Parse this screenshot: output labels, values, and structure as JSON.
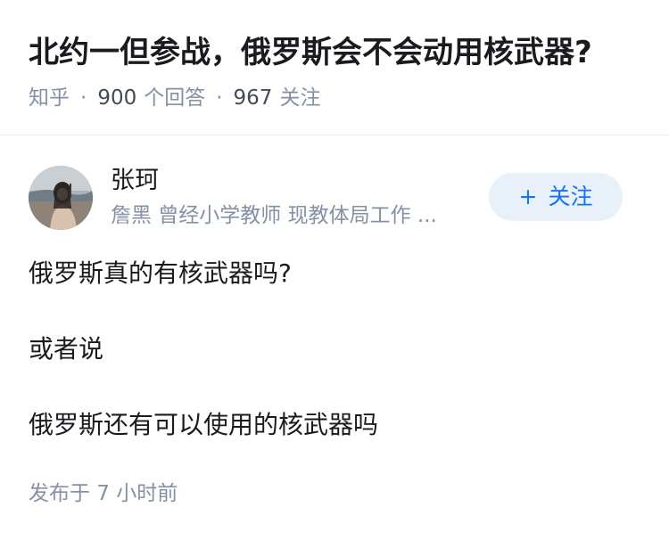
{
  "question": {
    "title": "北约一但参战，俄罗斯会不会动用核武器?",
    "source": "知乎",
    "answer_count": "900",
    "answer_label": "个回答",
    "follow_count": "967",
    "follow_label": "关注"
  },
  "author": {
    "name": "张珂",
    "bio": "詹黑 曾经小学教师 现教体局工作 ..."
  },
  "follow_button": {
    "plus": "+",
    "label": "关注"
  },
  "answer": {
    "paragraphs": [
      "俄罗斯真的有核武器吗?",
      "或者说",
      "俄罗斯还有可以使用的核武器吗"
    ],
    "publish_time": "发布于  7 小时前"
  },
  "colors": {
    "title": "#191b1f",
    "meta": "#8590a6",
    "accent": "#1772f6",
    "follow_bg": "#e8f0fa",
    "divider": "#ebedf0"
  }
}
